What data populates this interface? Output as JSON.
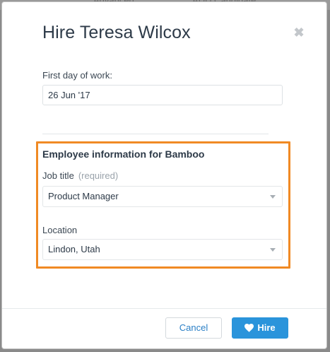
{
  "background": {
    "tab_left": "Advanced",
    "tab_right": "ADD Candidate"
  },
  "modal": {
    "title": "Hire Teresa Wilcox",
    "close_symbol": "✖"
  },
  "first_day": {
    "label": "First day of work:",
    "value": "26 Jun '17"
  },
  "employee_info": {
    "title": "Employee information for Bamboo",
    "job_title_label": "Job title",
    "job_title_required": "(required)",
    "job_title_value": "Product Manager",
    "location_label": "Location",
    "location_value": "Lindon, Utah"
  },
  "footer": {
    "cancel_label": "Cancel",
    "hire_label": "Hire"
  },
  "colors": {
    "accent": "#2a94db",
    "highlight": "#f08a24"
  }
}
